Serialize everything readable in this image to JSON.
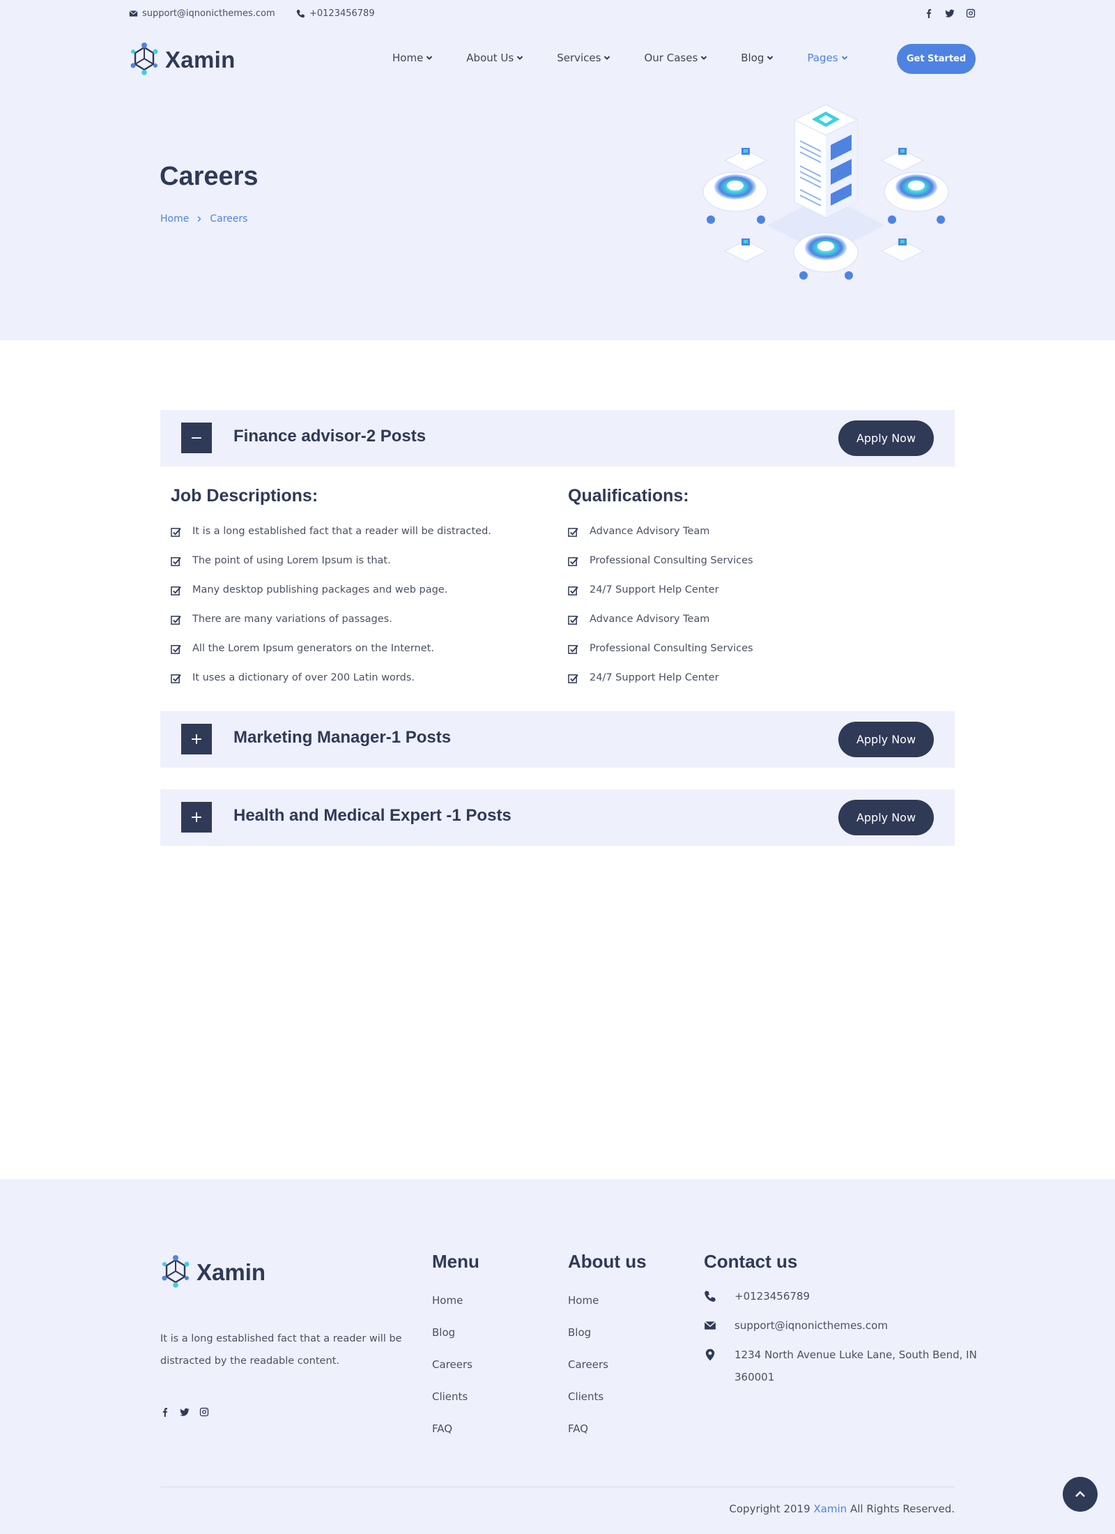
{
  "topbar": {
    "email": "support@iqnonicthemes.com",
    "phone": "+0123456789",
    "social_icons": [
      "facebook-icon",
      "twitter-icon",
      "instagram-icon"
    ]
  },
  "brand": {
    "name": "Xamin"
  },
  "nav": {
    "items": [
      {
        "label": "Home"
      },
      {
        "label": "About Us"
      },
      {
        "label": "Services"
      },
      {
        "label": "Our Cases"
      },
      {
        "label": "Blog"
      },
      {
        "label": "Pages",
        "active": true
      }
    ],
    "cta_label": "Get Started"
  },
  "hero": {
    "title": "Careers",
    "breadcrumb": [
      "Home",
      "Careers"
    ]
  },
  "jobs": [
    {
      "title": "Finance advisor-2 Posts",
      "toggle": "−",
      "expanded": true,
      "apply_label": "Apply Now",
      "descriptions_title": "Job Descriptions:",
      "descriptions": [
        "It is a long established fact that a reader will be distracted.",
        "The point of using Lorem Ipsum is that.",
        "Many desktop publishing packages and web page.",
        "There are many variations of passages.",
        "All the Lorem Ipsum generators on the Internet.",
        "It uses a dictionary of over 200 Latin words."
      ],
      "qualifications_title": "Qualifications:",
      "qualifications": [
        "Advance Advisory Team",
        "Professional Consulting Services",
        "24/7 Support Help Center",
        "Advance Advisory Team",
        "Professional Consulting Services",
        "24/7 Support Help Center"
      ]
    },
    {
      "title": "Marketing Manager-1 Posts",
      "toggle": "+",
      "expanded": false,
      "apply_label": "Apply Now"
    },
    {
      "title": "Health and Medical Expert -1 Posts",
      "toggle": "+",
      "expanded": false,
      "apply_label": "Apply Now"
    }
  ],
  "footer": {
    "brand_name": "Xamin",
    "about_text": "It is a long established fact that a reader will be distracted by the readable content.",
    "menu_title": "Menu",
    "menu_links": [
      "Home",
      "Blog",
      "Careers",
      "Clients",
      "FAQ"
    ],
    "about_title": "About us",
    "about_links": [
      "Home",
      "Blog",
      "Careers",
      "Clients",
      "FAQ"
    ],
    "contact_title": "Contact us",
    "contact": {
      "phone": "+0123456789",
      "email": "support@iqnonicthemes.com",
      "address": "1234 North Avenue Luke Lane, South Bend, IN 360001"
    },
    "copyright_prefix": "Copyright 2019",
    "copyright_brand": "Xamin",
    "copyright_suffix": "All Rights Reserved."
  },
  "colors": {
    "accent": "#4e83e2",
    "dark": "#2f3a56",
    "light_bg": "#eef0fb"
  }
}
